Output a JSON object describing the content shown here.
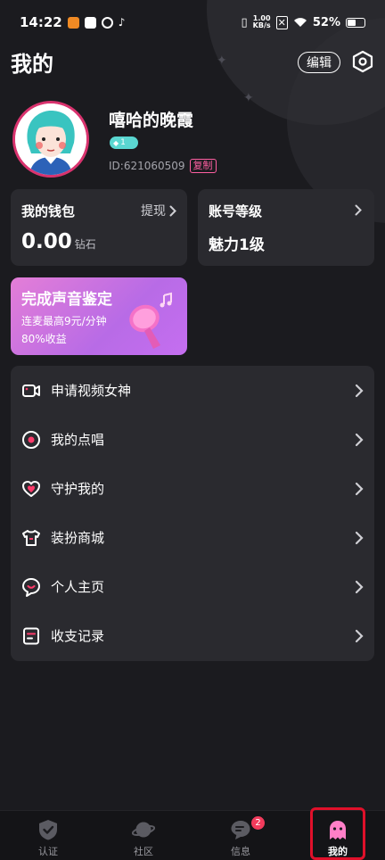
{
  "status_bar": {
    "time": "14:22",
    "net_speed_value": "1.00",
    "net_speed_unit": "KB/s",
    "battery": "52%"
  },
  "header": {
    "title": "我的",
    "edit_label": "编辑"
  },
  "profile": {
    "name": "嘻哈的晚霞",
    "level_badge": "1",
    "id_text": "ID:621060509",
    "copy_label": "复制"
  },
  "wallet": {
    "title": "我的钱包",
    "action": "提现",
    "amount": "0.00",
    "unit": "钻石"
  },
  "account_level": {
    "title": "账号等级",
    "value": "魅力1级"
  },
  "voice_banner": {
    "title": "完成声音鉴定",
    "line1": "连麦最高9元/分钟",
    "line2": "80%收益"
  },
  "menu": {
    "items": [
      {
        "label": "申请视频女神",
        "icon": "video-camera-icon"
      },
      {
        "label": "我的点唱",
        "icon": "record-disc-icon"
      },
      {
        "label": "守护我的",
        "icon": "heart-icon"
      },
      {
        "label": "装扮商城",
        "icon": "tshirt-icon"
      },
      {
        "label": "个人主页",
        "icon": "chat-face-icon"
      },
      {
        "label": "收支记录",
        "icon": "ledger-icon"
      }
    ]
  },
  "bottom_nav": {
    "items": [
      {
        "label": "认证",
        "icon": "shield-check-icon"
      },
      {
        "label": "社区",
        "icon": "planet-icon"
      },
      {
        "label": "信息",
        "icon": "message-icon",
        "badge": "2"
      },
      {
        "label": "我的",
        "icon": "ghost-icon"
      }
    ],
    "active_index": 3
  },
  "colors": {
    "background": "#1b1b1f",
    "card": "#2a2a2f",
    "accent_pink": "#ff5fa2",
    "badge_red": "#f23b5c",
    "highlight_red": "#e0102a"
  }
}
